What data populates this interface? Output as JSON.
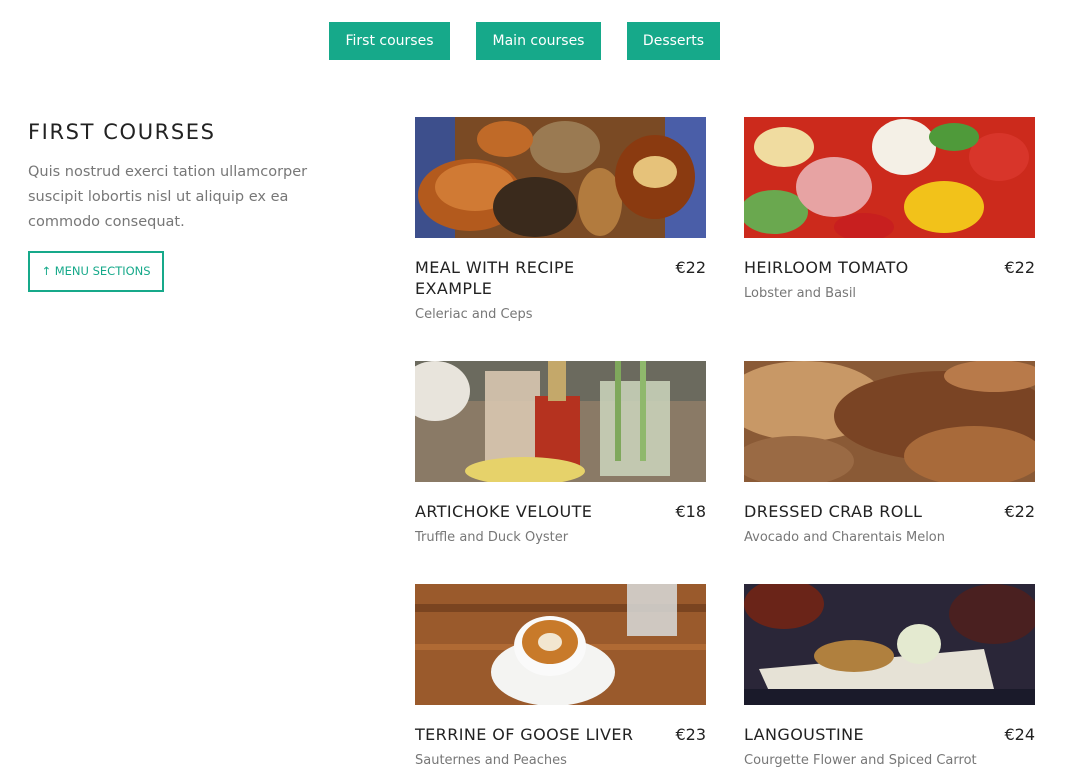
{
  "tabs": [
    "First courses",
    "Main courses",
    "Desserts"
  ],
  "section": {
    "title": "FIRST COURSES",
    "description": "Quis nostrud exerci tation ullamcorper suscipit lobortis nisl ut aliquip ex ea commodo consequat.",
    "menu_button": "↑ MENU SECTIONS"
  },
  "dishes": [
    {
      "name": "MEAL WITH RECIPE EXAMPLE",
      "price": "€22",
      "desc": "Celeriac and Ceps",
      "image": "bread-rolls-photo"
    },
    {
      "name": "HEIRLOOM TOMATO",
      "price": "€22",
      "desc": "Lobster and Basil",
      "image": "salad-photo"
    },
    {
      "name": "ARTICHOKE VELOUTE",
      "price": "€18",
      "desc": "Truffle and Duck Oyster",
      "image": "shrimp-cocktail-photo"
    },
    {
      "name": "DRESSED CRAB ROLL",
      "price": "€22",
      "desc": "Avocado and Charentais Melon",
      "image": "rustic-bread-photo"
    },
    {
      "name": "TERRINE OF GOOSE LIVER",
      "price": "€23",
      "desc": "Sauternes and Peaches",
      "image": "latte-art-photo"
    },
    {
      "name": "LANGOUSTINE",
      "price": "€24",
      "desc": "Courgette Flower and Spiced Carrot",
      "image": "appetizer-plate-photo"
    }
  ],
  "colors": {
    "accent": "#16a98a",
    "text": "#222222",
    "muted": "#777777"
  }
}
